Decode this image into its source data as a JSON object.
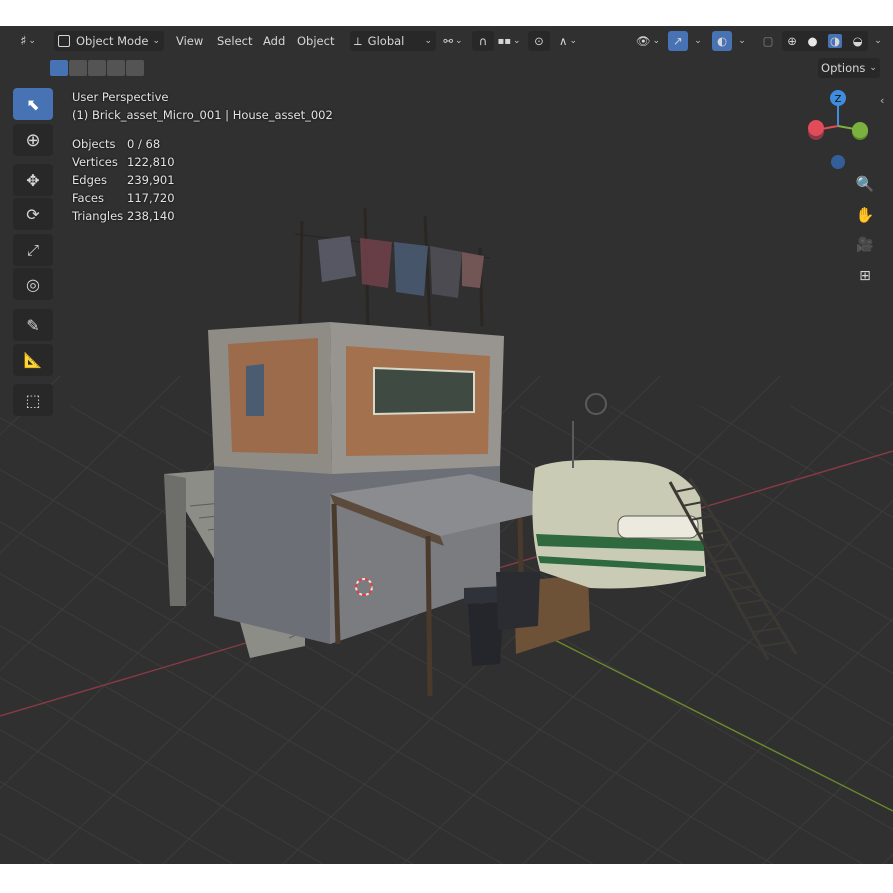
{
  "header": {
    "editor_type_icon": "grid-editor-icon",
    "mode_label": "Object Mode",
    "menus": [
      "View",
      "Select",
      "Add",
      "Object"
    ],
    "transform_orientation": "Global",
    "options_label": "Options"
  },
  "toolbar": {
    "tools": [
      "select-box",
      "cursor",
      "move",
      "rotate",
      "scale",
      "transform",
      "annotate",
      "measure",
      "add-cube"
    ],
    "active_tool": "select-box"
  },
  "viewport": {
    "perspective_label": "User Perspective",
    "object_label": "(1) Brick_asset_Micro_001 | House_asset_002",
    "stats": [
      {
        "label": "Objects",
        "value": "0 / 68"
      },
      {
        "label": "Vertices",
        "value": "122,810"
      },
      {
        "label": "Edges",
        "value": "239,901"
      },
      {
        "label": "Faces",
        "value": "117,720"
      },
      {
        "label": "Triangles",
        "value": "238,140"
      }
    ]
  },
  "gizmo": {
    "z_label": "Z",
    "x_color": "#e14b5a",
    "y_color": "#7bb23f",
    "z_color": "#3e8ddf"
  },
  "colors": {
    "accent": "#4772b3",
    "background": "#303030",
    "panel": "#282828"
  }
}
